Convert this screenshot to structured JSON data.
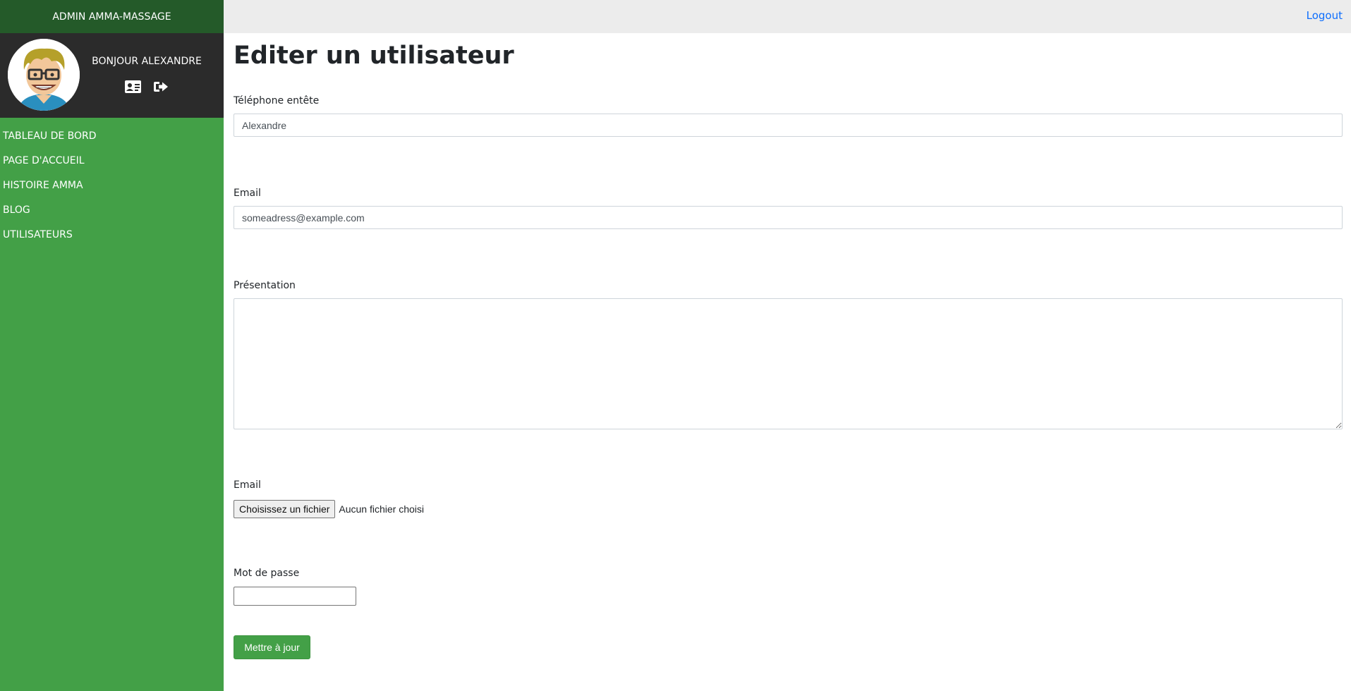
{
  "sidebar": {
    "brand": "ADMIN AMMA-MASSAGE",
    "greeting": "BONJOUR ALEXANDRE",
    "profile_icons": [
      "id-card-icon",
      "sign-out-icon"
    ],
    "nav": [
      "TABLEAU DE BORD",
      "PAGE D'ACCUEIL",
      "HISTOIRE AMMA",
      "BLOG",
      "UTILISATEURS"
    ]
  },
  "topbar": {
    "logout": "Logout"
  },
  "page": {
    "title": "Editer un utilisateur"
  },
  "form": {
    "phone": {
      "label": "Téléphone entête",
      "value": "Alexandre"
    },
    "email": {
      "label": "Email",
      "value": "someadress@example.com"
    },
    "presentation": {
      "label": "Présentation",
      "value": ""
    },
    "file": {
      "label": "Email",
      "button": "Choisissez un fichier",
      "status": "Aucun fichier choisi"
    },
    "password": {
      "label": "Mot de passe",
      "value": ""
    },
    "submit": "Mettre à jour"
  },
  "colors": {
    "sidebar_green": "#43a047",
    "brand_dark_green": "#245a29",
    "profile_dark": "#2b2b2b",
    "topbar_gray": "#ececec",
    "link_blue": "#0d6efd"
  }
}
